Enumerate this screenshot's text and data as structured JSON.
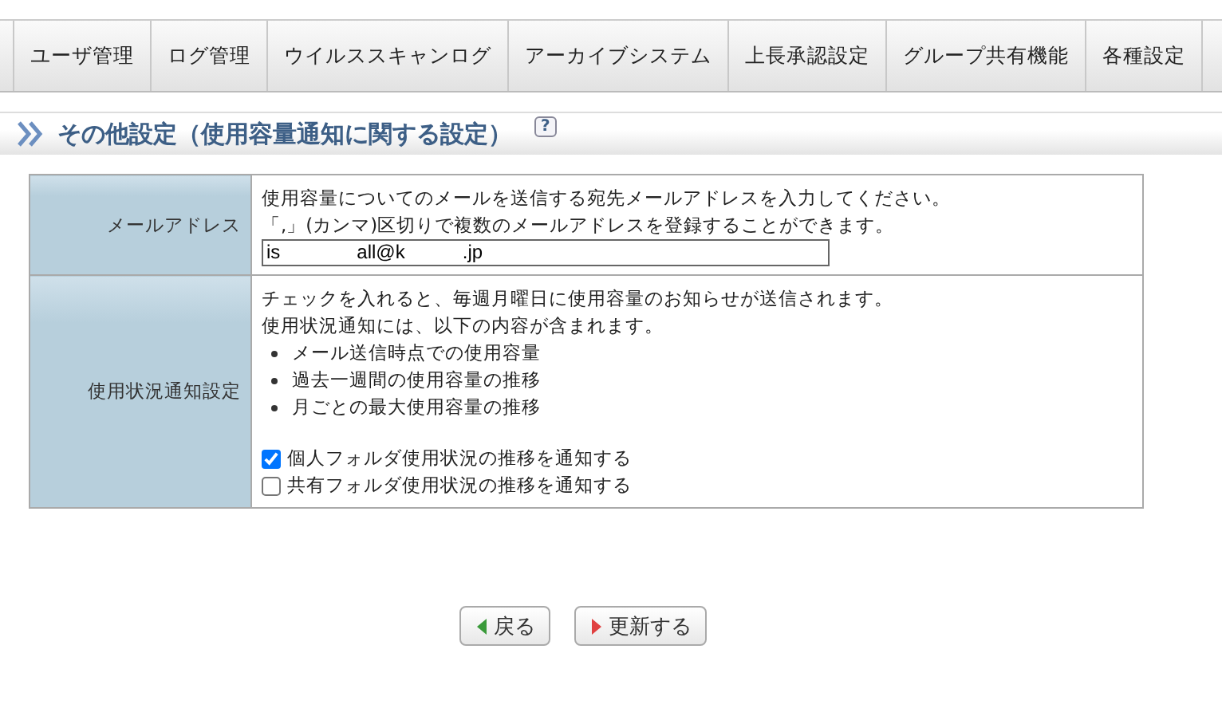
{
  "tabs": [
    {
      "label": "ユーザ管理",
      "selected": false
    },
    {
      "label": "ログ管理",
      "selected": false
    },
    {
      "label": "ウイルススキャンログ",
      "selected": false
    },
    {
      "label": "アーカイブシステム",
      "selected": false
    },
    {
      "label": "上長承認設定",
      "selected": false
    },
    {
      "label": "グループ共有機能",
      "selected": false
    },
    {
      "label": "各種設定",
      "selected": false
    }
  ],
  "heading": {
    "title": "その他設定（使用容量通知に関する設定）",
    "help": "?"
  },
  "form": {
    "email": {
      "label": "メールアドレス",
      "lines": [
        "使用容量についてのメールを送信する宛先メールアドレスを入力してください。",
        "「,」(カンマ)区切りで複数のメールアドレスを登録することができます。"
      ],
      "value": "is　　　　all@k　　　.jp"
    },
    "notify": {
      "label": "使用状況通知設定",
      "lines": [
        "チェックを入れると、毎週月曜日に使用容量のお知らせが送信されます。",
        "使用状況通知には、以下の内容が含まれます。"
      ],
      "bullets": [
        "メール送信時点での使用容量",
        "過去一週間の使用容量の推移",
        "月ごとの最大使用容量の推移"
      ],
      "options": [
        {
          "label": "個人フォルダ使用状況の推移を通知する",
          "checked": true
        },
        {
          "label": "共有フォルダ使用状況の推移を通知する",
          "checked": false
        }
      ]
    }
  },
  "buttons": [
    {
      "label": "戻る",
      "kind": "back"
    },
    {
      "label": "更新する",
      "kind": "submit"
    }
  ]
}
